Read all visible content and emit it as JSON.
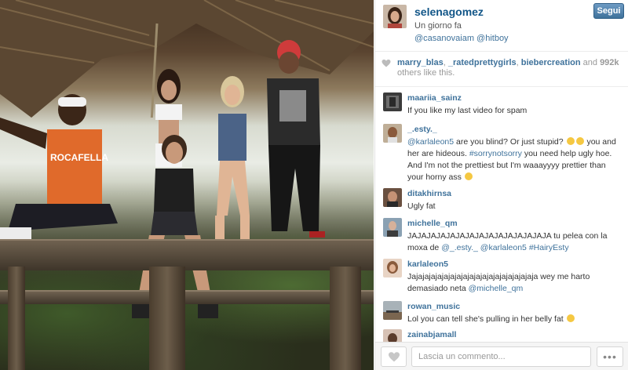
{
  "post": {
    "author": "selenagomez",
    "time_ago": "Un giorno fa",
    "tags": "@casanovaiam @hitboy",
    "follow_label": "Segui",
    "photo_shirt_text": "ROCAFELLA"
  },
  "likes": {
    "user1": "marry_blas",
    "sep1": ", ",
    "user2": "_ratedprettygirls",
    "sep2": ", ",
    "user3": "biebercreation",
    "and": " and ",
    "count": "992k",
    "tail": " others like this."
  },
  "comments": [
    {
      "user": "maariia_sainz",
      "t1": "If you like my last video for spam"
    },
    {
      "user": "_.esty._",
      "m1": "@karlaleon5",
      "t1": " are you blind? Or just stupid? ",
      "t2": " you and her are hideous. ",
      "m2": "#sorrynotsorry",
      "t3": " you need help ugly hoe. And I'm not the prettiest but I'm waaayyyy prettier than your horny ass "
    },
    {
      "user": "ditakhirnsa",
      "t1": "Ugly fat"
    },
    {
      "user": "michelle_qm",
      "t1": "JAJAJAJAJAJAJAJAJAJAJAJAJAJAJA tu pelea con la moxa de ",
      "m1": "@_.esty._",
      "m2": "@karlaleon5",
      "m3": "#HairyEsty"
    },
    {
      "user": "karlaleon5",
      "t1": "Jajajajajajajajajajajajajajajajajajajaja wey me harto demasiado neta ",
      "m1": "@michelle_qm"
    },
    {
      "user": "rowan_music",
      "t1": "Lol you can tell she's pulling in her belly fat "
    },
    {
      "user": "zainabjamall"
    }
  ],
  "footer": {
    "comment_placeholder": "Lascia un commento...",
    "more_label": "•••"
  },
  "colors": {
    "link": "#3f729b",
    "username": "#125688",
    "button": "#3f729b"
  },
  "icons": [
    "heart-icon",
    "more-icon",
    "emoji-icon"
  ]
}
